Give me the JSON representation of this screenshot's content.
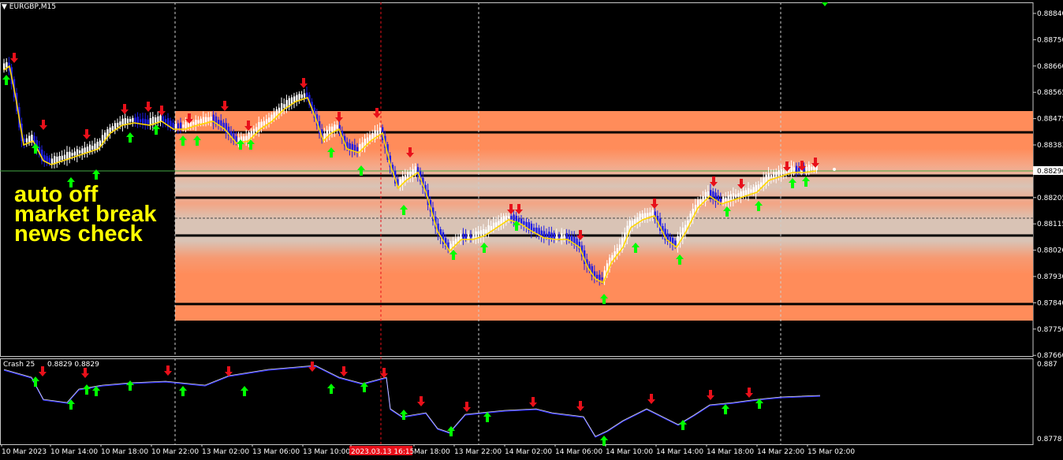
{
  "chart": {
    "symbol": "EURGBP,M15",
    "current_price": "0.88296"
  },
  "annotation": {
    "line1": "auto off",
    "line2": "market break",
    "line3": "news check"
  },
  "indicator": {
    "name": "Crash 25",
    "values": "0.8829 0.8829",
    "axis_top": "0.887",
    "axis_bottom": "0.8778"
  },
  "price_axis": [
    "0.88840",
    "0.88750",
    "0.88660",
    "0.88565",
    "0.88475",
    "0.88383",
    "0.88295",
    "0.88205",
    "0.88115",
    "0.88020",
    "0.87930",
    "0.87840",
    "0.87750",
    "0.87660"
  ],
  "time_axis": [
    "10 Mar 2023",
    "10 Mar 14:00",
    "10 Mar 18:00",
    "10 Mar 22:00",
    "13 Mar 02:00",
    "13 Mar 06:00",
    "13 Mar 10:00",
    "2023.03.13 16:15",
    "Mar 18:00",
    "13 Mar 22:00",
    "14 Mar 02:00",
    "14 Mar 06:00",
    "14 Mar 10:00",
    "14 Mar 14:00",
    "14 Mar 18:00",
    "14 Mar 22:00",
    "15 Mar 02:00"
  ],
  "colors": {
    "zone_orange": "#ff8c5a",
    "zone_light": "#d9c3b5",
    "bull_candle": "#ffffff",
    "bear_candle": "#1e1ee6",
    "ma_line": "#ffd700",
    "up_arrow": "#00ff00",
    "down_arrow": "#e8101a",
    "highlight": "#e8101a"
  }
}
